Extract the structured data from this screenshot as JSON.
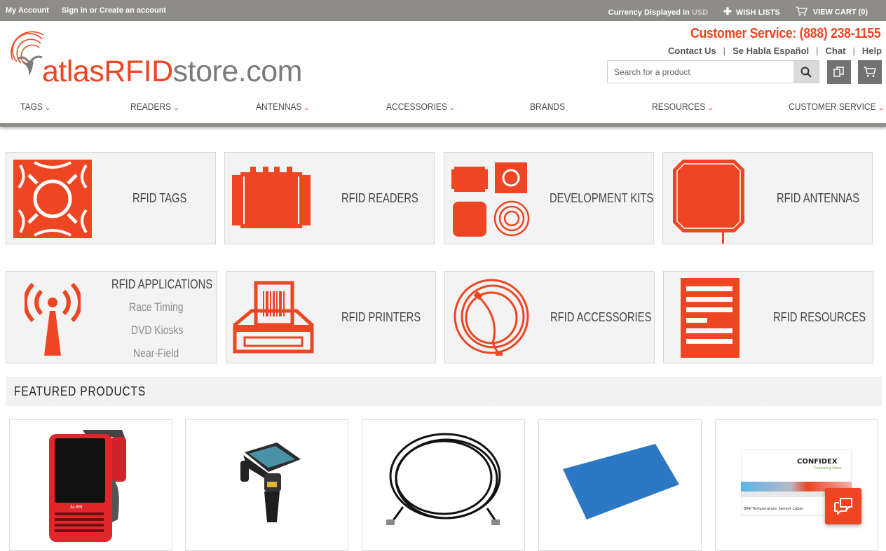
{
  "topbar": {
    "my_account": "My Account",
    "sign_in": "Sign in or Create an account",
    "currency_label": "Currency Displayed in",
    "currency_value": "USD",
    "wishlists": "WISH LISTS",
    "view_cart": "VIEW CART (0)"
  },
  "header": {
    "logo_part1": "atlasRFID",
    "logo_part2": "store.com",
    "customer_service": "Customer Service: (888) 238-1155",
    "links": [
      "Contact Us",
      "Se Habla Español",
      "Chat",
      "Help"
    ],
    "search_placeholder": "Search for a product"
  },
  "nav": [
    "TAGS",
    "READERS",
    "ANTENNAS",
    "ACCESSORIES",
    "BRANDS",
    "RESOURCES",
    "CUSTOMER SERVICE"
  ],
  "categories": [
    {
      "label": "RFID TAGS"
    },
    {
      "label": "RFID READERS"
    },
    {
      "label": "DEVELOPMENT KITS"
    },
    {
      "label": "RFID ANTENNAS"
    },
    {
      "label": "RFID APPLICATIONS",
      "sub": [
        "Race Timing",
        "DVD Kiosks",
        "Near-Field"
      ]
    },
    {
      "label": "RFID PRINTERS"
    },
    {
      "label": "RFID ACCESSORIES"
    },
    {
      "label": "RFID RESOURCES"
    }
  ],
  "featured": {
    "title": "FEATURED PRODUCTS",
    "products": [
      {
        "image": "handheld-rfid-reader-red",
        "brand_text": "ALIEN"
      },
      {
        "image": "handheld-rfid-sled-scanner"
      },
      {
        "image": "coiled-antenna-cable"
      },
      {
        "image": "blue-rfid-mat-antenna"
      },
      {
        "image": "confidex-temperature-sensor-label",
        "brand_text": "CONFIDEX",
        "tagline": "Capturing Ideas",
        "caption": "BAP Temperature Sensor Label"
      }
    ]
  },
  "colors": {
    "accent": "#ee4523",
    "topbar": "#8e8c89",
    "tile_bg": "#f3f3f3"
  }
}
